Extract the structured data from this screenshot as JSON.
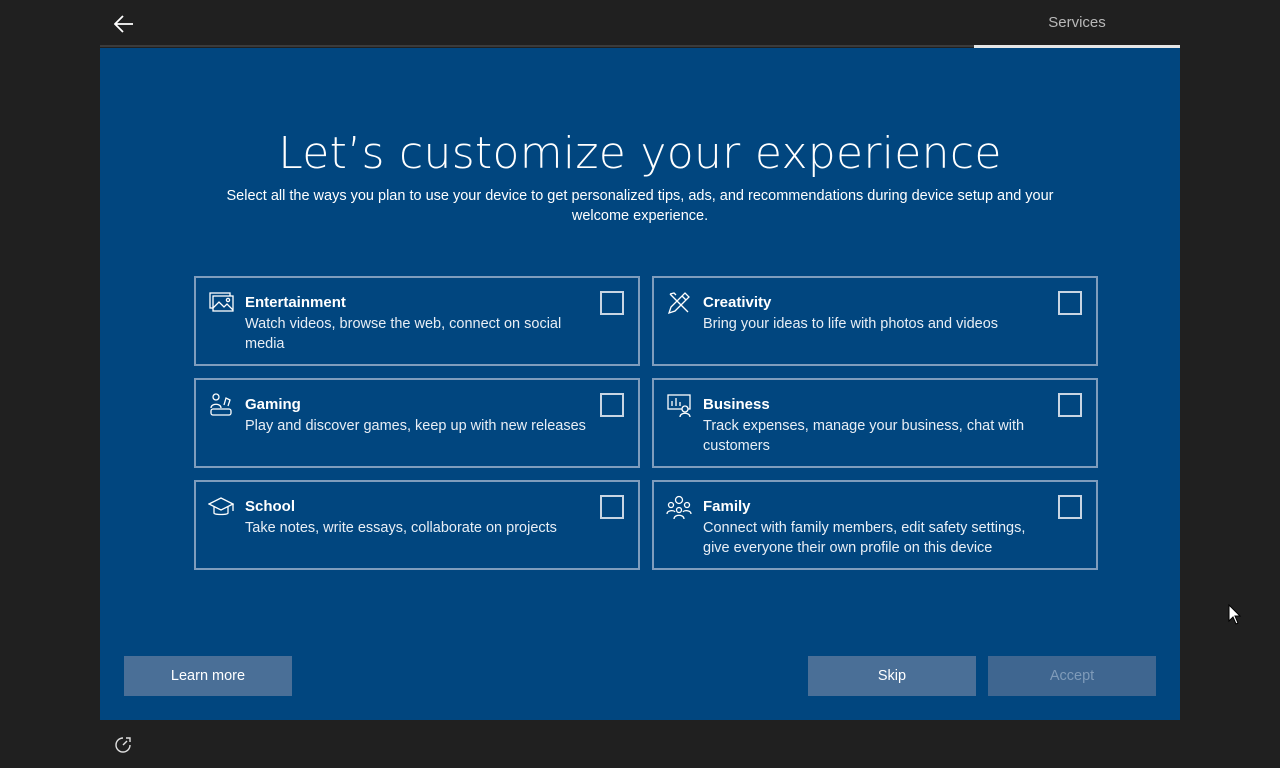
{
  "header": {
    "back_icon": "arrow-left-icon",
    "section_label": "Services"
  },
  "main": {
    "title": "Let’s customize your experience",
    "subtitle": "Select all the ways you plan to use your device to get personalized tips, ads, and recommendations during device setup and your welcome experience."
  },
  "options": [
    {
      "icon": "entertainment-icon",
      "title": "Entertainment",
      "description": "Watch videos, browse the web, connect on social media",
      "checked": false
    },
    {
      "icon": "creativity-icon",
      "title": "Creativity",
      "description": "Bring your ideas to life with photos and videos",
      "checked": false
    },
    {
      "icon": "gaming-icon",
      "title": "Gaming",
      "description": "Play and discover games, keep up with new releases",
      "checked": false
    },
    {
      "icon": "business-icon",
      "title": "Business",
      "description": "Track expenses, manage your business, chat with customers",
      "checked": false
    },
    {
      "icon": "school-icon",
      "title": "School",
      "description": "Take notes, write essays, collaborate on projects",
      "checked": false
    },
    {
      "icon": "family-icon",
      "title": "Family",
      "description": "Connect with family members, edit safety settings, give everyone their own profile on this device",
      "checked": false
    }
  ],
  "footer": {
    "learn_more_label": "Learn more",
    "skip_label": "Skip",
    "accept_label": "Accept",
    "accept_disabled": true
  },
  "bottom": {
    "accessibility_icon": "accessibility-icon"
  },
  "colors": {
    "panel": "#01467f",
    "background": "#202020",
    "button": "#4a6f97",
    "card_border": "#7f9dbd"
  }
}
